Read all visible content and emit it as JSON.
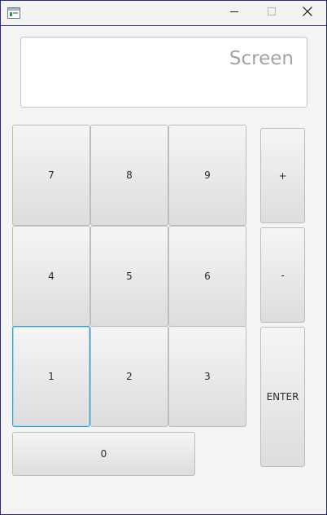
{
  "display": {
    "placeholder": "Screen"
  },
  "keypad": {
    "seven": "7",
    "eight": "8",
    "nine": "9",
    "four": "4",
    "five": "5",
    "six": "6",
    "one": "1",
    "two": "2",
    "three": "3",
    "zero": "0"
  },
  "operators": {
    "plus": "+",
    "minus": "-",
    "enter": "ENTER"
  },
  "titlebar": {
    "icons": [
      "app-icon",
      "minimize-icon",
      "maximize-icon",
      "close-icon"
    ]
  },
  "colors": {
    "frame_border": "#2b2b86",
    "focus_ring": "#2b9fd8",
    "placeholder_text": "#a3a3a3"
  }
}
